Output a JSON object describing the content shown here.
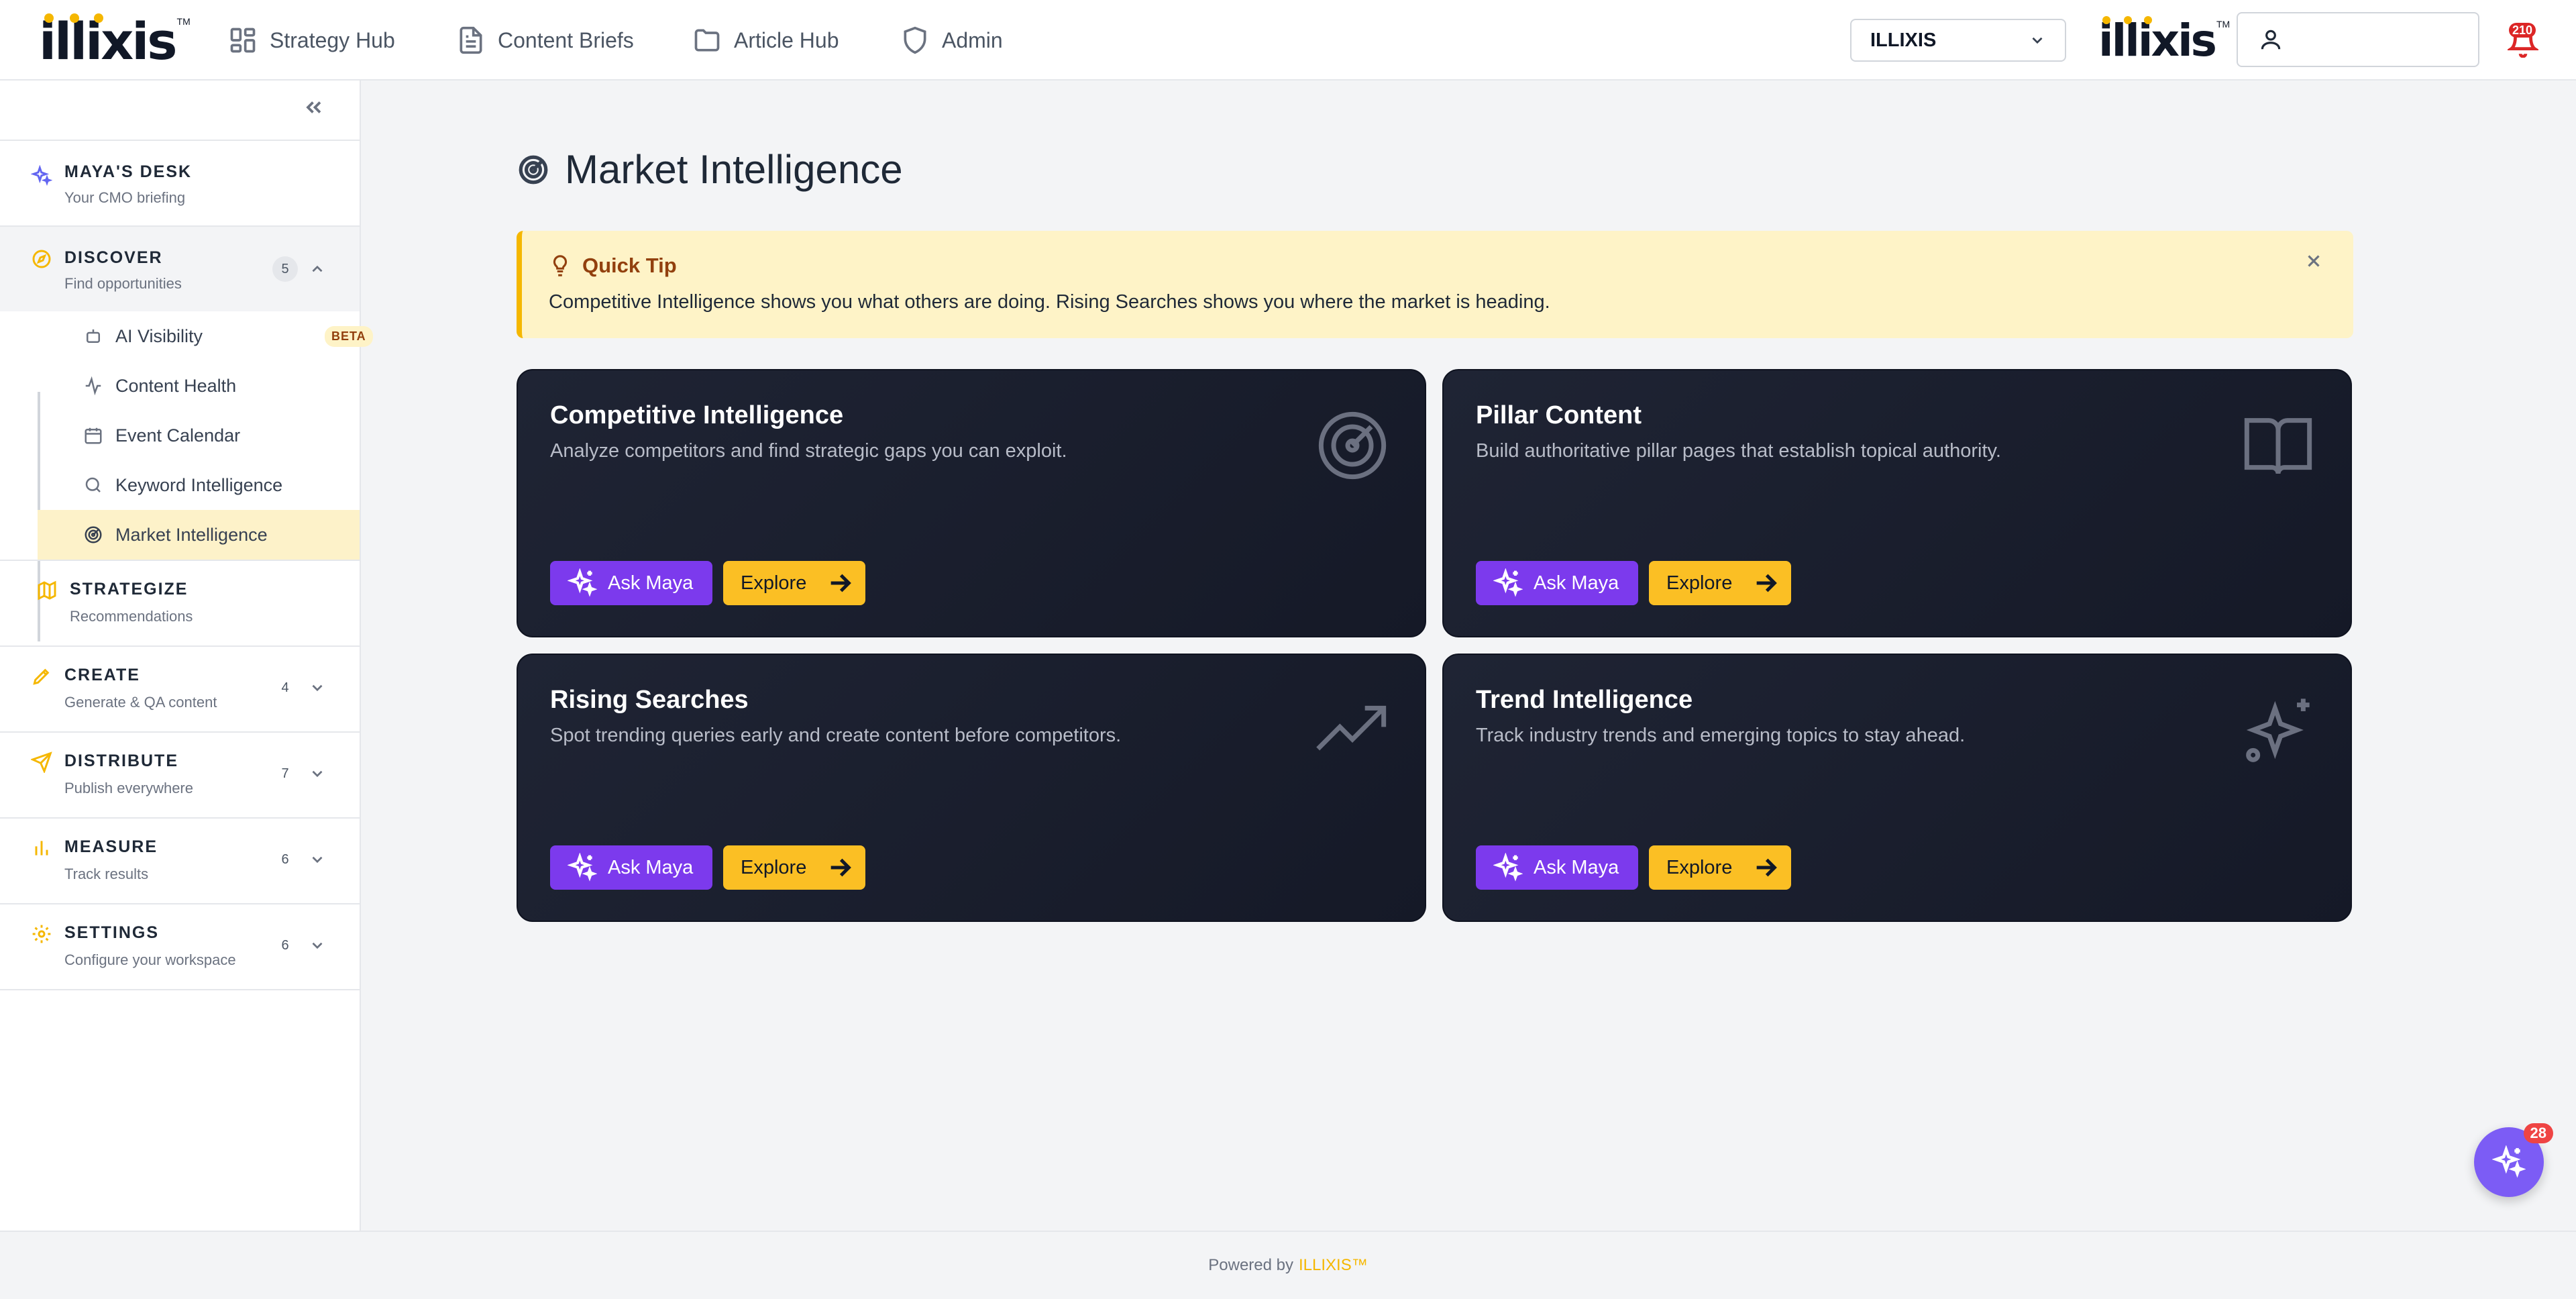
{
  "topnav": {
    "logo_text": "illixis",
    "logo_tm": "TM",
    "links": [
      {
        "label": "Strategy Hub",
        "icon": "grid-icon"
      },
      {
        "label": "Content Briefs",
        "icon": "document-icon"
      },
      {
        "label": "Article Hub",
        "icon": "folder-icon"
      },
      {
        "label": "Admin",
        "icon": "shield-icon"
      }
    ],
    "org_select": "ILLIXIS",
    "notification_count": "210"
  },
  "sidebar": {
    "sections": [
      {
        "title": "MAYA'S DESK",
        "subtitle": "Your CMO briefing"
      },
      {
        "title": "DISCOVER",
        "subtitle": "Find opportunities",
        "count": "5"
      },
      {
        "title": "STRATEGIZE",
        "subtitle": "Recommendations"
      },
      {
        "title": "CREATE",
        "subtitle": "Generate & QA content",
        "count": "4"
      },
      {
        "title": "DISTRIBUTE",
        "subtitle": "Publish everywhere",
        "count": "7"
      },
      {
        "title": "MEASURE",
        "subtitle": "Track results",
        "count": "6"
      },
      {
        "title": "SETTINGS",
        "subtitle": "Configure your workspace",
        "count": "6"
      }
    ],
    "discover_items": [
      {
        "label": "AI Visibility",
        "badge": "BETA"
      },
      {
        "label": "Content Health"
      },
      {
        "label": "Event Calendar"
      },
      {
        "label": "Keyword Intelligence"
      },
      {
        "label": "Market Intelligence",
        "active": true
      }
    ]
  },
  "main": {
    "title": "Market Intelligence",
    "tip": {
      "title": "Quick Tip",
      "text": "Competitive Intelligence shows you what others are doing. Rising Searches shows you where the market is heading."
    },
    "cards": [
      {
        "title": "Competitive Intelligence",
        "desc": "Analyze competitors and find strategic gaps you can exploit.",
        "icon": "radar-icon"
      },
      {
        "title": "Pillar Content",
        "desc": "Build authoritative pillar pages that establish topical authority.",
        "icon": "book-icon"
      },
      {
        "title": "Rising Searches",
        "desc": "Spot trending queries early and create content before competitors.",
        "icon": "trending-up-icon"
      },
      {
        "title": "Trend Intelligence",
        "desc": "Track industry trends and emerging topics to stay ahead.",
        "icon": "sparkle-icon"
      }
    ],
    "ask_label": "Ask Maya",
    "explore_label": "Explore"
  },
  "fab": {
    "count": "28"
  },
  "footer": {
    "prefix": "Powered by",
    "brand": "ILLIXIS™"
  },
  "colors": {
    "accent_yellow": "#f5b700",
    "maya_purple": "#7c3aed",
    "card_dark": "#1b2030"
  }
}
